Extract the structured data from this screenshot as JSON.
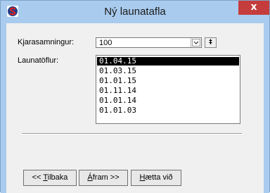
{
  "window": {
    "title": "Ný launatafla",
    "close_glyph": "x",
    "app_icon": "s-logo-icon",
    "accent_color": "#a9cbee"
  },
  "form": {
    "agreement_label": "Kjarasamningur:",
    "agreement_value": "100",
    "combo_arrow_icon": "chevron-down-icon",
    "small_button_glyph": "‡",
    "tables_label": "Launatöflur:",
    "tables": [
      "01.04.15",
      "01.03.15",
      "01.01.15",
      "01.11.14",
      "01.01.14",
      "01.01.03"
    ],
    "selected_index": 0
  },
  "buttons": {
    "back_prefix": "<< ",
    "back_mnemonic": "T",
    "back_rest": "ilbaka",
    "next_mnemonic": "Á",
    "next_rest": "fram >>",
    "cancel_mnemonic": "H",
    "cancel_rest": "ætta við"
  }
}
